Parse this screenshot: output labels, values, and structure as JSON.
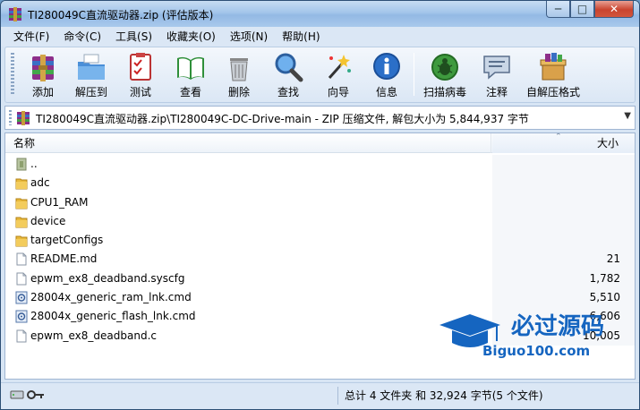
{
  "window": {
    "title": "TI280049C直流驱动器.zip (评估版本)",
    "controls": {
      "minimize": "─",
      "maximize": "□",
      "close": "✕"
    }
  },
  "menu": [
    "文件(F)",
    "命令(C)",
    "工具(S)",
    "收藏夹(O)",
    "选项(N)",
    "帮助(H)"
  ],
  "toolbar": {
    "buttons": [
      {
        "label": "添加",
        "icon": "add-archive-icon"
      },
      {
        "label": "解压到",
        "icon": "extract-to-icon"
      },
      {
        "label": "测试",
        "icon": "test-icon"
      },
      {
        "label": "查看",
        "icon": "view-icon"
      },
      {
        "label": "删除",
        "icon": "delete-icon"
      },
      {
        "label": "查找",
        "icon": "find-icon"
      },
      {
        "label": "向导",
        "icon": "wizard-icon"
      },
      {
        "label": "信息",
        "icon": "info-icon"
      },
      {
        "label": "扫描病毒",
        "icon": "scan-virus-icon"
      },
      {
        "label": "注释",
        "icon": "comment-icon"
      },
      {
        "label": "自解压格式",
        "icon": "sfx-icon"
      }
    ]
  },
  "address": {
    "path": "TI280049C直流驱动器.zip\\TI280049C-DC-Drive-main - ZIP 压缩文件, 解包大小为 5,844,937 字节"
  },
  "columns": {
    "name": "名称",
    "size": "大小"
  },
  "files": [
    {
      "name": "..",
      "size": "",
      "type": "parent"
    },
    {
      "name": "adc",
      "size": "",
      "type": "folder"
    },
    {
      "name": "CPU1_RAM",
      "size": "",
      "type": "folder"
    },
    {
      "name": "device",
      "size": "",
      "type": "folder"
    },
    {
      "name": "targetConfigs",
      "size": "",
      "type": "folder"
    },
    {
      "name": "README.md",
      "size": "21",
      "type": "file"
    },
    {
      "name": "epwm_ex8_deadband.syscfg",
      "size": "1,782",
      "type": "file"
    },
    {
      "name": "28004x_generic_ram_lnk.cmd",
      "size": "5,510",
      "type": "cmd"
    },
    {
      "name": "28004x_generic_flash_lnk.cmd",
      "size": "6,606",
      "type": "cmd"
    },
    {
      "name": "epwm_ex8_deadband.c",
      "size": "10,005",
      "type": "file"
    }
  ],
  "watermark": {
    "title": "必过源码",
    "url": "Biguo100.com"
  },
  "status": {
    "summary": "总计 4 文件夹 和 32,924 字节(5 个文件)"
  },
  "colors": {
    "folder": "#e8b93b",
    "accent": "#1a58b8",
    "watermark_blue": "#1565c0"
  }
}
